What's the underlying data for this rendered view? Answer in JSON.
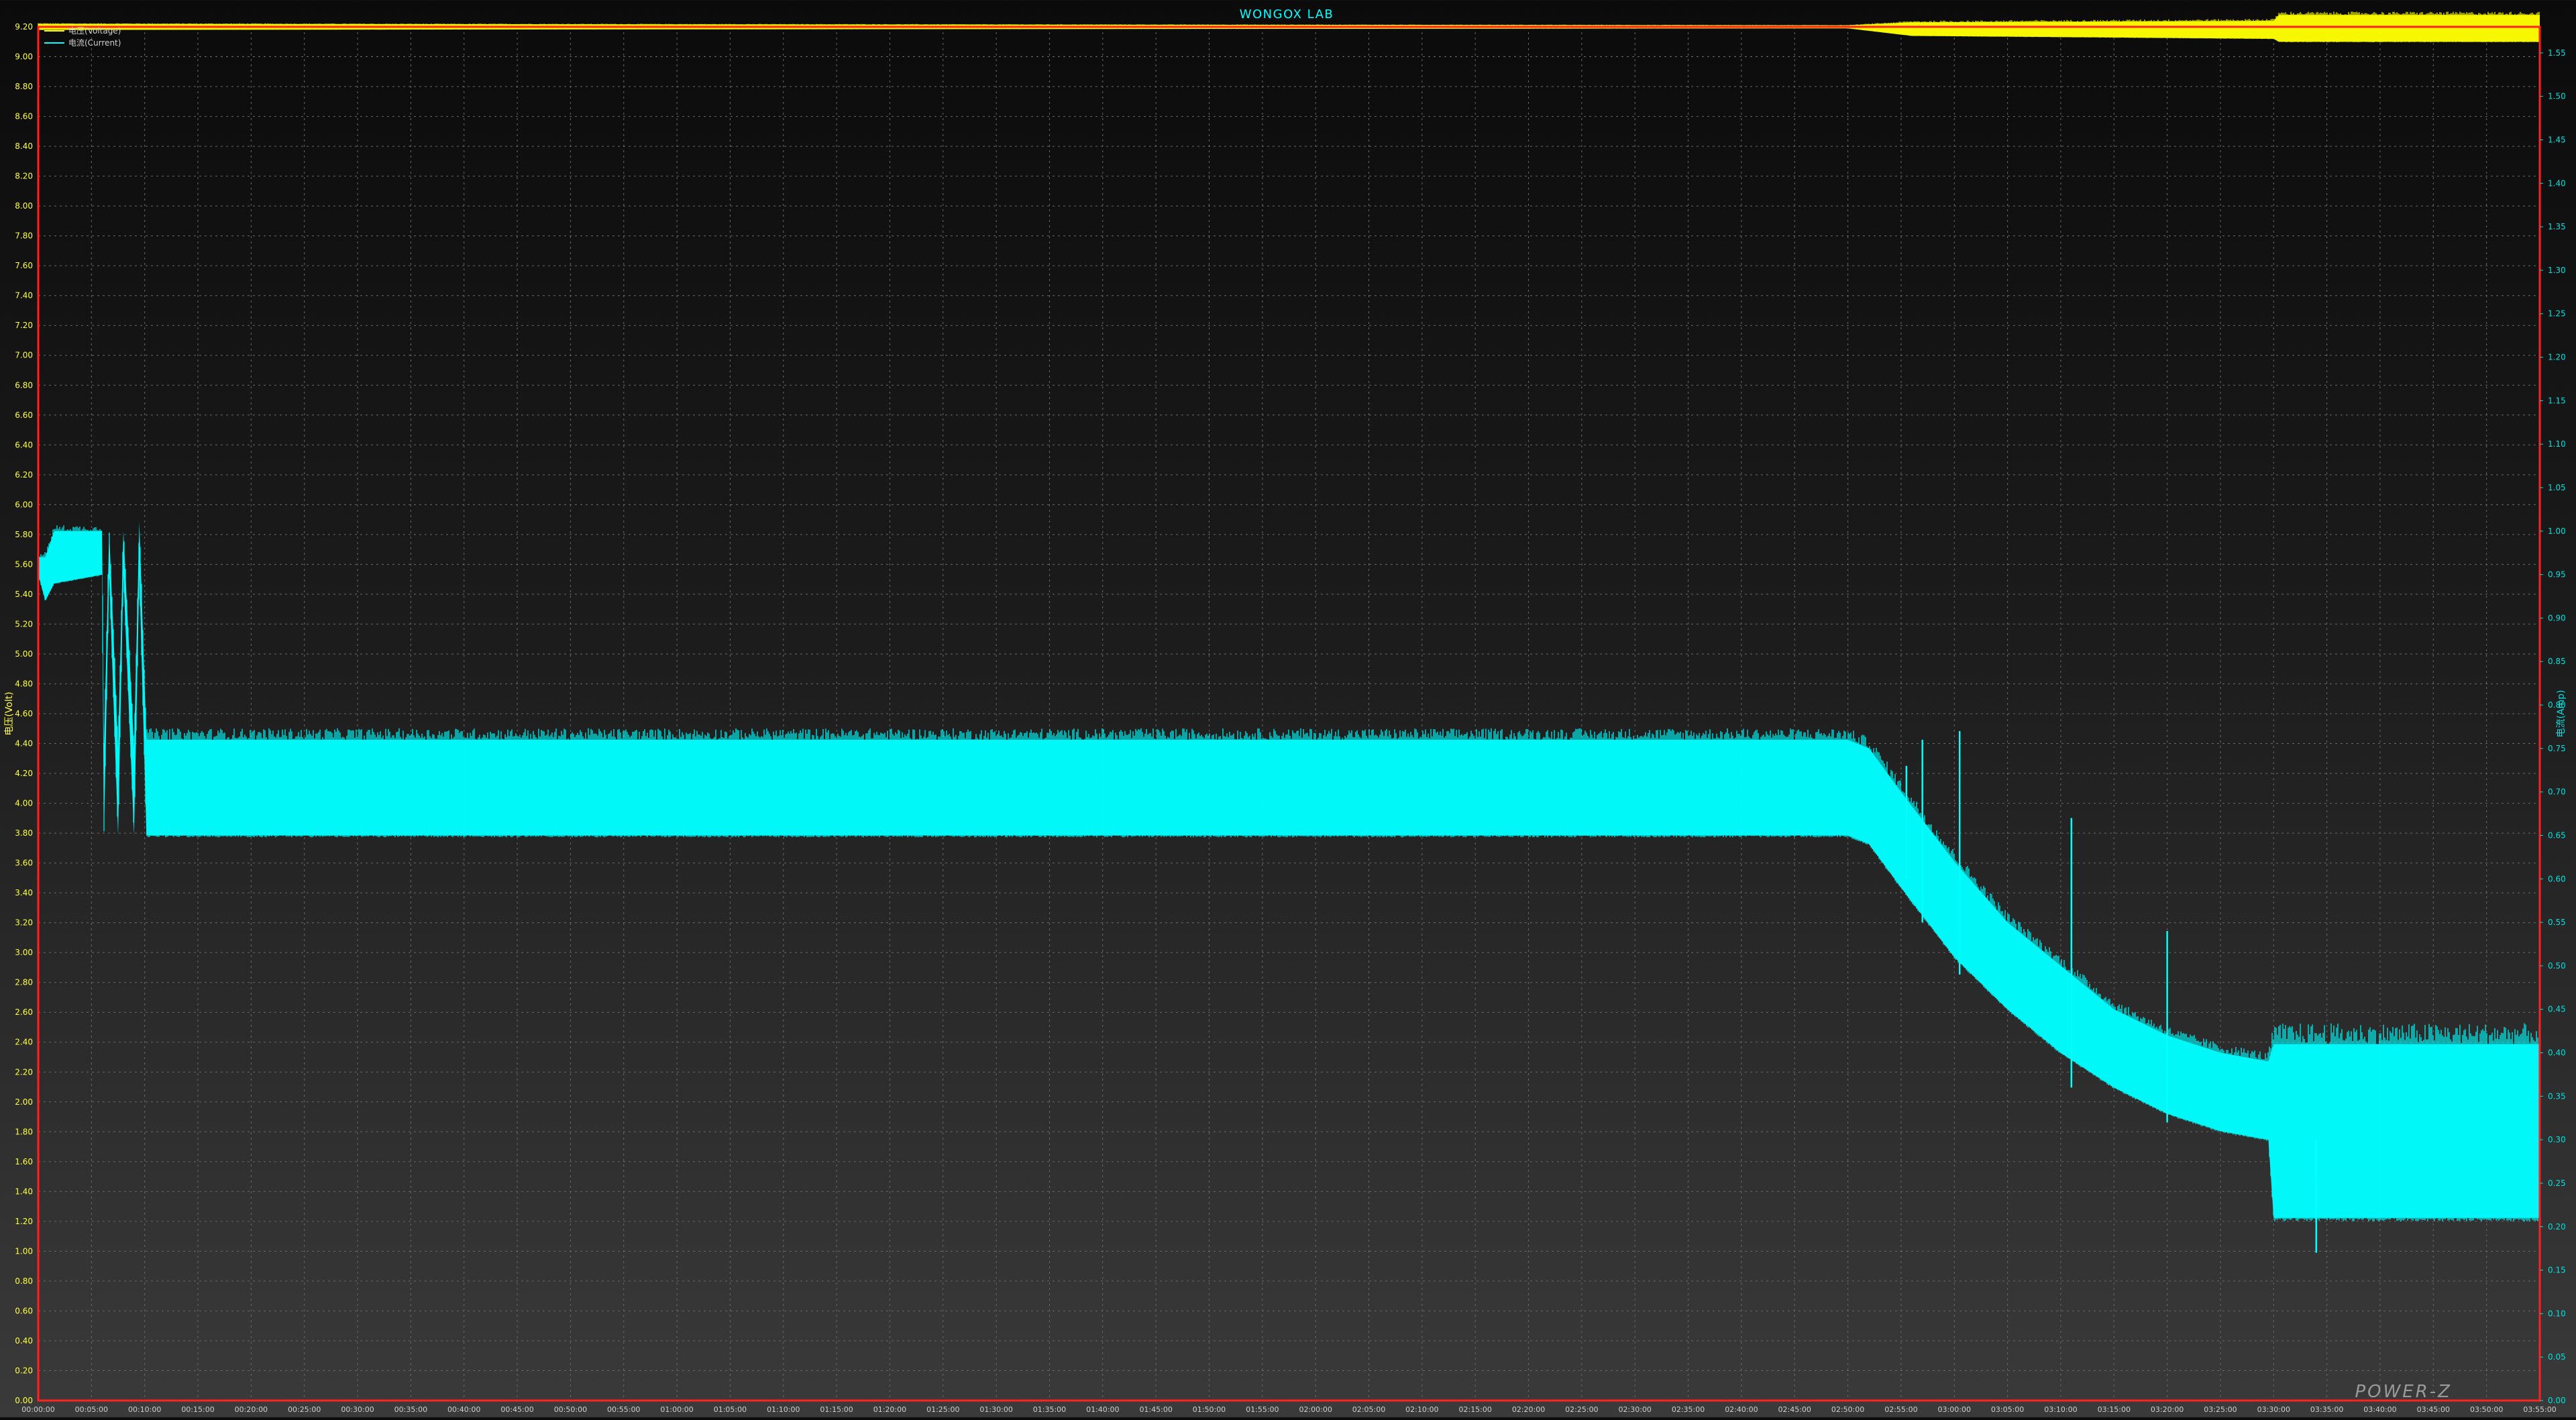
{
  "chart_data": {
    "type": "line",
    "title": "WONGOX LAB",
    "watermark": "POWER-Z",
    "colors": {
      "voltage": "#ffff00",
      "current": "#00ffff",
      "frame": "#ff2020",
      "title": "#00ffff",
      "left_axis": "#ffff40",
      "right_axis": "#00e0e0",
      "x_axis": "#d0d0d0",
      "grid": "#6a6a6a",
      "legend_text": "#cfcfcf",
      "watermark": "#9a9a9a"
    },
    "legend": {
      "placement": "top-left",
      "items": [
        {
          "key": "voltage",
          "label": "电压(Voltage)"
        },
        {
          "key": "current",
          "label": "电流(Current)"
        }
      ]
    },
    "y_left": {
      "label": "电压(Volt)",
      "min": 0,
      "max": 9.2,
      "ticks": [
        "0.00",
        "0.20",
        "0.40",
        "0.60",
        "0.80",
        "1.00",
        "1.20",
        "1.40",
        "1.60",
        "1.80",
        "2.00",
        "2.20",
        "2.40",
        "2.60",
        "2.80",
        "3.00",
        "3.20",
        "3.40",
        "3.60",
        "3.80",
        "4.00",
        "4.20",
        "4.40",
        "4.60",
        "4.80",
        "5.00",
        "5.20",
        "5.40",
        "5.60",
        "5.80",
        "6.00",
        "6.20",
        "6.40",
        "6.60",
        "6.80",
        "7.00",
        "7.20",
        "7.40",
        "7.60",
        "7.80",
        "8.00",
        "8.20",
        "8.40",
        "8.60",
        "8.80",
        "9.00",
        "9.20"
      ]
    },
    "y_right": {
      "label": "电流(Amp)",
      "min": 0,
      "max": 1.58,
      "ticks": [
        "0.00",
        "0.05",
        "0.10",
        "0.15",
        "0.20",
        "0.25",
        "0.30",
        "0.35",
        "0.40",
        "0.45",
        "0.50",
        "0.55",
        "0.60",
        "0.65",
        "0.70",
        "0.75",
        "0.80",
        "0.85",
        "0.90",
        "0.95",
        "1.00",
        "1.05",
        "1.10",
        "1.15",
        "1.20",
        "1.25",
        "1.30",
        "1.35",
        "1.40",
        "1.45",
        "1.50",
        "1.55"
      ]
    },
    "x_axis": {
      "unit": "time",
      "min": "00:00:00",
      "max": "03:55:00",
      "ticks": [
        "00:00:00",
        "00:05:00",
        "00:10:00",
        "00:15:00",
        "00:20:00",
        "00:25:00",
        "00:30:00",
        "00:35:00",
        "00:40:00",
        "00:45:00",
        "00:50:00",
        "00:55:00",
        "01:00:00",
        "01:05:00",
        "01:10:00",
        "01:15:00",
        "01:20:00",
        "01:25:00",
        "01:30:00",
        "01:35:00",
        "01:40:00",
        "01:45:00",
        "01:50:00",
        "01:55:00",
        "02:00:00",
        "02:05:00",
        "02:10:00",
        "02:15:00",
        "02:20:00",
        "02:25:00",
        "02:30:00",
        "02:35:00",
        "02:40:00",
        "02:45:00",
        "02:50:00",
        "02:55:00",
        "03:00:00",
        "03:05:00",
        "03:10:00",
        "03:15:00",
        "03:20:00",
        "03:25:00",
        "03:30:00",
        "03:35:00",
        "03:40:00",
        "03:45:00",
        "03:50:00",
        "03:55:00"
      ]
    },
    "grid": true,
    "series": [
      {
        "key": "voltage",
        "name": "电压(Voltage)",
        "axis": "left",
        "envelope": [
          {
            "t": "00:00:00",
            "min": 9.18,
            "max": 9.22
          },
          {
            "t": "02:50:00",
            "min": 9.19,
            "max": 9.21
          },
          {
            "t": "02:56:00",
            "min": 9.14,
            "max": 9.23
          },
          {
            "t": "03:30:00",
            "min": 9.12,
            "max": 9.24
          },
          {
            "t": "03:30:30",
            "min": 9.1,
            "max": 9.28
          },
          {
            "t": "03:55:00",
            "min": 9.1,
            "max": 9.28
          }
        ]
      },
      {
        "key": "current",
        "name": "电流(Current)",
        "axis": "right",
        "envelope": [
          {
            "t": "00:00:00",
            "min": 0.95,
            "max": 0.97
          },
          {
            "t": "00:00:40",
            "min": 0.92,
            "max": 0.97
          },
          {
            "t": "00:01:30",
            "min": 0.94,
            "max": 1.0
          },
          {
            "t": "00:06:00",
            "min": 0.95,
            "max": 1.0
          },
          {
            "t": "00:06:10",
            "min": 0.65,
            "max": 0.75
          },
          {
            "t": "00:06:40",
            "min": 0.95,
            "max": 1.0
          },
          {
            "t": "00:07:30",
            "min": 0.65,
            "max": 0.75
          },
          {
            "t": "00:08:00",
            "min": 0.95,
            "max": 1.0
          },
          {
            "t": "00:09:00",
            "min": 0.65,
            "max": 0.75
          },
          {
            "t": "00:09:30",
            "min": 0.95,
            "max": 1.01
          },
          {
            "t": "00:10:10",
            "min": 0.65,
            "max": 0.76
          },
          {
            "t": "00:25:00",
            "min": 0.65,
            "max": 0.76
          },
          {
            "t": "02:50:00",
            "min": 0.65,
            "max": 0.76
          },
          {
            "t": "02:52:00",
            "min": 0.64,
            "max": 0.75
          },
          {
            "t": "02:55:00",
            "min": 0.59,
            "max": 0.7
          },
          {
            "t": "03:00:00",
            "min": 0.51,
            "max": 0.62
          },
          {
            "t": "03:05:00",
            "min": 0.45,
            "max": 0.55
          },
          {
            "t": "03:10:00",
            "min": 0.4,
            "max": 0.5
          },
          {
            "t": "03:15:00",
            "min": 0.36,
            "max": 0.45
          },
          {
            "t": "03:20:00",
            "min": 0.33,
            "max": 0.42
          },
          {
            "t": "03:25:00",
            "min": 0.31,
            "max": 0.4
          },
          {
            "t": "03:29:30",
            "min": 0.3,
            "max": 0.39
          },
          {
            "t": "03:30:00",
            "min": 0.21,
            "max": 0.41
          },
          {
            "t": "03:55:00",
            "min": 0.21,
            "max": 0.41
          }
        ],
        "spikes": [
          {
            "t": "02:55:30",
            "min": 0.6,
            "max": 0.73
          },
          {
            "t": "02:57:00",
            "min": 0.55,
            "max": 0.76
          },
          {
            "t": "03:00:30",
            "min": 0.49,
            "max": 0.77
          },
          {
            "t": "03:11:00",
            "min": 0.36,
            "max": 0.67
          },
          {
            "t": "03:20:00",
            "min": 0.32,
            "max": 0.54
          },
          {
            "t": "03:34:00",
            "min": 0.17,
            "max": 0.3
          }
        ]
      }
    ]
  }
}
